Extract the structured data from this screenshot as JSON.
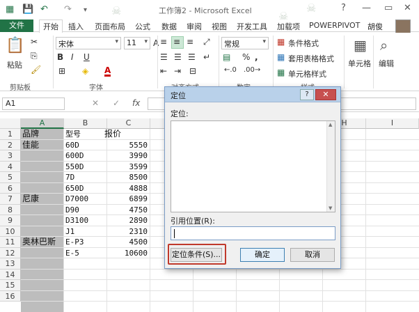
{
  "window": {
    "title": "工作簿2 - Microsoft Excel",
    "help": "?",
    "minimize": "—",
    "restore": "▭",
    "close": "✕"
  },
  "ribbon_tabs": {
    "file": "文件",
    "tabs": [
      "开始",
      "插入",
      "页面布局",
      "公式",
      "数据",
      "审阅",
      "视图",
      "开发工具",
      "加载项",
      "POWERPIVOT"
    ],
    "user": "胡俊"
  },
  "ribbon": {
    "clipboard": {
      "paste": "粘贴",
      "label": "剪贴板"
    },
    "font": {
      "name": "宋体",
      "size": "11",
      "bold": "B",
      "italic": "I",
      "underline": "U",
      "grow": "A",
      "shrink": "A",
      "label": "字体",
      "font_color": "A"
    },
    "alignment": {
      "label": "对齐方式"
    },
    "number": {
      "format": "常规",
      "percent": "%",
      "comma": ",",
      "label": "数字"
    },
    "styles": {
      "conditional": "条件格式",
      "table": "套用表格格式",
      "cell": "单元格样式",
      "label": "样式"
    },
    "cells": {
      "label": "单元格"
    },
    "editing": {
      "label": "编辑"
    }
  },
  "formula_bar": {
    "name_box": "A1",
    "cancel": "✕",
    "enter": "✓",
    "fx": "fx",
    "value": ""
  },
  "sheet": {
    "columns": [
      "A",
      "B",
      "C",
      "D",
      "E",
      "F",
      "G",
      "H",
      "I"
    ],
    "rows": [
      "1",
      "2",
      "3",
      "4",
      "5",
      "6",
      "7",
      "8",
      "9",
      "10",
      "11",
      "12",
      "13",
      "14",
      "15",
      "16"
    ],
    "cells": [
      {
        "a": "品牌",
        "b": "型号",
        "c": "报价"
      },
      {
        "a": "佳能",
        "b": "60D",
        "c": "5550"
      },
      {
        "a": "",
        "b": "600D",
        "c": "3990"
      },
      {
        "a": "",
        "b": "550D",
        "c": "3599"
      },
      {
        "a": "",
        "b": "7D",
        "c": "8500"
      },
      {
        "a": "",
        "b": "650D",
        "c": "4888"
      },
      {
        "a": "尼康",
        "b": "D7000",
        "c": "6899"
      },
      {
        "a": "",
        "b": "D90",
        "c": "4750"
      },
      {
        "a": "",
        "b": "D3100",
        "c": "2890"
      },
      {
        "a": "",
        "b": "J1",
        "c": "2310"
      },
      {
        "a": "奥林巴斯",
        "b": "E-P3",
        "c": "4500"
      },
      {
        "a": "",
        "b": "E-5",
        "c": "10600"
      }
    ]
  },
  "dialog": {
    "title": "定位",
    "help": "?",
    "close": "✕",
    "goto_label": "定位:",
    "reference_label": "引用位置(R):",
    "reference_value": "",
    "special_button": "定位条件(S)...",
    "ok_button": "确定",
    "cancel_button": "取消"
  }
}
